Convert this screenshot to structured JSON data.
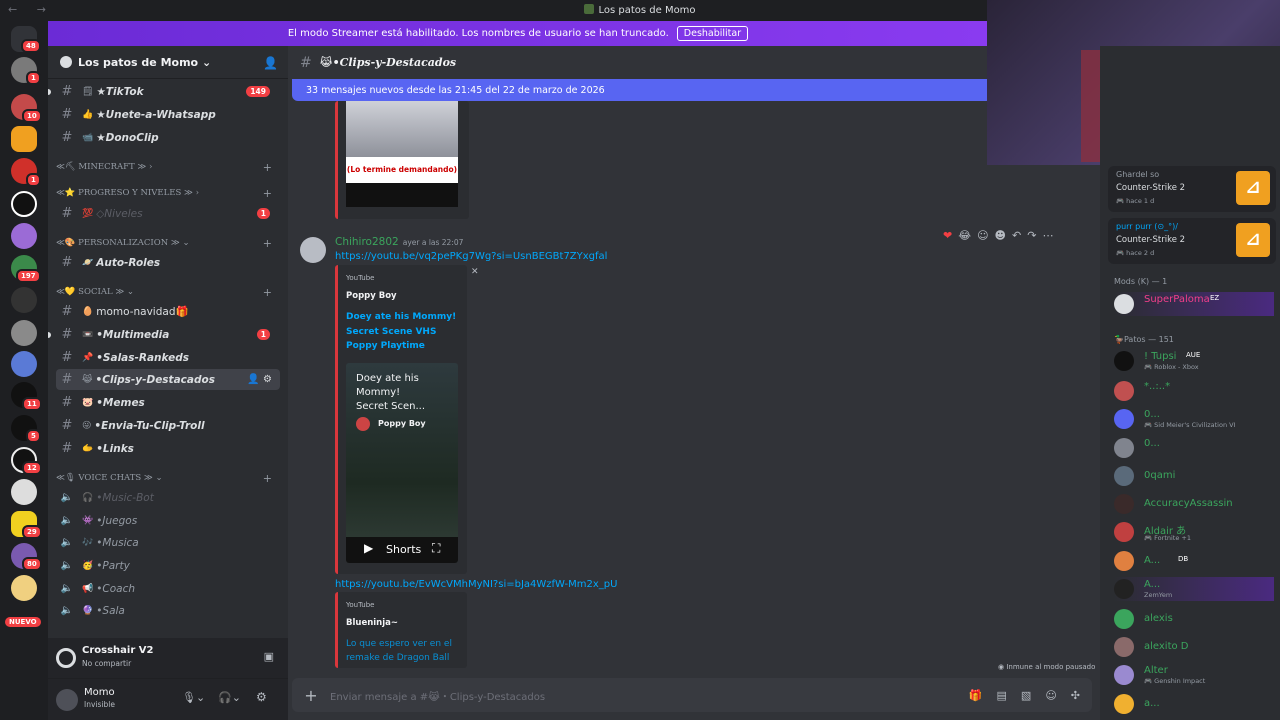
{
  "window": {
    "title": "Los patos de Momo",
    "nav": "← →"
  },
  "banner": {
    "text": "El modo Streamer está habilitado. Los nombres de usuario se han truncado.",
    "button": "Deshabilitar"
  },
  "rail": {
    "badges": [
      "48",
      "1",
      "10",
      "1",
      "197",
      "11",
      "5",
      "12",
      "29",
      "80"
    ],
    "new_label": "NUEVO"
  },
  "guild": {
    "name": "Los patos de Momo ⌄"
  },
  "channels": {
    "tiktok": {
      "emoji": "🗒",
      "name": "★TikTok",
      "count": "149"
    },
    "whatsapp": {
      "emoji": "👍",
      "name": "★Unete-a-Whatsapp"
    },
    "donoclip": {
      "emoji": "📹",
      "name": "★DonoClip"
    },
    "cat_minecraft": "≪⛏ MINECRAFT ≫ ›",
    "cat_progreso": "≪⭐ PROGRESO Y NIVELES ≫ ›",
    "niveles": {
      "emoji": "💯",
      "name": "◇Niveles",
      "count": "1"
    },
    "cat_personalizacion": "≪🎨 PERSONALIZACION ≫ ⌄",
    "autoroles": {
      "emoji": "🪐",
      "name": "Auto-Roles"
    },
    "cat_social": "≪💛 SOCIAL ≫ ⌄",
    "navidad": {
      "emoji": "🥚",
      "name": "momo-navidad🎁"
    },
    "multimedia": {
      "emoji": "📼",
      "name": "•Multimedia",
      "count": "1"
    },
    "rankeds": {
      "emoji": "📌",
      "name": "•Salas-Rankeds"
    },
    "clips": {
      "emoji": "😹",
      "name": "•Clips-y-Destacados"
    },
    "memes": {
      "emoji": "🐷",
      "name": "•Memes"
    },
    "troll": {
      "emoji": "😜",
      "name": "•Envia-Tu-Clip-Troll"
    },
    "links": {
      "emoji": "🫱",
      "name": "•Links"
    },
    "cat_voice": "≪🎙 VOICE CHATS ≫ ⌄",
    "musicbot": {
      "emoji": "🎧",
      "name": "•Music-Bot"
    },
    "juegos": {
      "emoji": "👾",
      "name": "•Juegos"
    },
    "musica": {
      "emoji": "🎶",
      "name": "•Musica"
    },
    "party": {
      "emoji": "🥳",
      "name": "•Party"
    },
    "coach": {
      "emoji": "📢",
      "name": "•Coach"
    },
    "sala": {
      "emoji": "🔮",
      "name": "•Sala"
    }
  },
  "activity_panel": {
    "title": "Crosshair V2",
    "subtitle": "No compartir"
  },
  "user_panel": {
    "name": "Momo",
    "status": "Invisible"
  },
  "chat": {
    "channel_emoji": "😹",
    "channel_name": "•Clips-y-Destacados",
    "new_messages": "33 mensajes nuevos desde las 21:45 del 22 de marzo de 2026",
    "embed_caption": "(Lo termine demandando)",
    "author": "Chihiro2802",
    "timestamp": "ayer a las 22:07",
    "link1": "https://youtu.be/vq2pePKg7Wg?si=UsnBEGBt7ZYxgfal",
    "embed1": {
      "provider": "YouTube",
      "channel": "Poppy Boy",
      "title_line1": "Doey ate his Mommy!",
      "title_line2": "Secret Scene VHS",
      "title_line3": "Poppy Playtime",
      "video_title_1": "Doey ate his",
      "video_title_2": "Mommy!",
      "video_title_3": "Secret Scen...",
      "video_channel": "Poppy Boy",
      "shorts_label": "Shorts"
    },
    "link2": "https://youtu.be/EvWcVMhMyNI?si=bJa4WzfW-Mm2x_pU",
    "embed2": {
      "provider": "YouTube",
      "channel": "Blueninja~",
      "title_line1": "Lo que espero ver en el",
      "title_line2": "remake de Dragon Ball"
    },
    "paused": "Inmune al modo pausado",
    "composer_placeholder": "Enviar mensaje a #😹・Clips-y-Destacados"
  },
  "members": {
    "activity1": {
      "user": "Ghardel so",
      "game": "Counter-Strike 2",
      "ago": "🎮 hace 1 d"
    },
    "activity2": {
      "user": "purr purr (⊙_°)/",
      "game": "Counter-Strike 2",
      "ago": "🎮 hace 2 d"
    },
    "mods_header": "Mods (K) — 1",
    "mod1": {
      "name": "SuperPaloma",
      "tag": "EZ"
    },
    "patos_header": "🦆Patos — 151",
    "list": [
      {
        "name": "! Tupsi",
        "tag": "AUE",
        "sub": "🎮 Roblox - Xbox",
        "color": "#3ba55d"
      },
      {
        "name": "*..:..*",
        "sub": "",
        "color": "#3ba55d"
      },
      {
        "name": "0...",
        "sub": "🎮 Sid Meier's Civilization VI",
        "color": "#3ba55d"
      },
      {
        "name": "0...",
        "sub": "",
        "color": "#3ba55d"
      },
      {
        "name": "0qami",
        "sub": "",
        "color": "#3ba55d"
      },
      {
        "name": "AccuracyAssassin",
        "sub": "",
        "color": "#3ba55d"
      },
      {
        "name": "Aldair あ",
        "sub": "🎮 Fortnite +1",
        "color": "#3ba55d"
      },
      {
        "name": "A...",
        "tag": "DB",
        "sub": "",
        "color": "#3ba55d"
      },
      {
        "name": "A...",
        "sub": "ZemYem",
        "color": "#3ba55d"
      },
      {
        "name": "alexis",
        "sub": "",
        "color": "#3ba55d"
      },
      {
        "name": "alexito D",
        "sub": "",
        "color": "#3ba55d"
      },
      {
        "name": "Alter",
        "sub": "🎮 Genshin Impact",
        "color": "#3ba55d"
      },
      {
        "name": "a...",
        "sub": "",
        "color": "#3ba55d"
      }
    ]
  }
}
